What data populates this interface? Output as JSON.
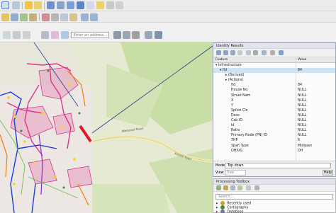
{
  "toolbar": {
    "address_placeholder": "Enter an address..."
  },
  "identify": {
    "title": "Identify Results",
    "columns": {
      "feature": "Feature",
      "value": "Value"
    },
    "rows": [
      {
        "f": "▾  Infrastructure",
        "v": "",
        "indent": 0
      },
      {
        "f": "▾  fid",
        "v": "84",
        "indent": 6,
        "sel": true
      },
      {
        "f": "▸  (Derived)",
        "v": "",
        "indent": 14
      },
      {
        "f": "▸  (Actions)",
        "v": "",
        "indent": 14
      },
      {
        "f": "fid",
        "v": "84",
        "indent": 22
      },
      {
        "f": "House No.",
        "v": "NULL",
        "indent": 22
      },
      {
        "f": "Street Nam",
        "v": "NULL",
        "indent": 22
      },
      {
        "f": "X",
        "v": "NULL",
        "indent": 22
      },
      {
        "f": "Y",
        "v": "NULL",
        "indent": 22
      },
      {
        "f": "Splice Clo",
        "v": "NULL",
        "indent": 22
      },
      {
        "f": "Desc",
        "v": "NULL",
        "indent": 22
      },
      {
        "f": "Cab ID",
        "v": "NULL",
        "indent": 22
      },
      {
        "f": "id",
        "v": "NULL",
        "indent": 22
      },
      {
        "f": "Ratio",
        "v": "NULL",
        "indent": 22
      },
      {
        "f": "Primary Node (PN) ID",
        "v": "NULL",
        "indent": 22
      },
      {
        "f": "THP",
        "v": "6",
        "indent": 22
      },
      {
        "f": "Span Type",
        "v": "Midspan",
        "indent": 22
      },
      {
        "f": "OH/UG",
        "v": "OH",
        "indent": 22
      }
    ],
    "mode_label": "Mode",
    "mode_value": "Top down",
    "view_label": "View",
    "view_value": "Tree",
    "help_label": "Help"
  },
  "toolbox": {
    "title": "Processing Toolbox",
    "search_placeholder": "Search...",
    "items": [
      {
        "label": "Recently used",
        "color": "#c9a227"
      },
      {
        "label": "Cartography",
        "color": "#4a8a3a"
      },
      {
        "label": "Database",
        "color": "#6b7fa3"
      }
    ]
  },
  "map": {
    "road_label_1": "Whiteleaf Road",
    "road_label_2": "Kirkhill Road"
  },
  "colors": {
    "accent": "#1f3c88",
    "selected_feature": "#e3171f",
    "fibre_pink": "#e0338c",
    "fibre_blue": "#1b3fd1",
    "fibre_orange": "#f07c0c"
  }
}
